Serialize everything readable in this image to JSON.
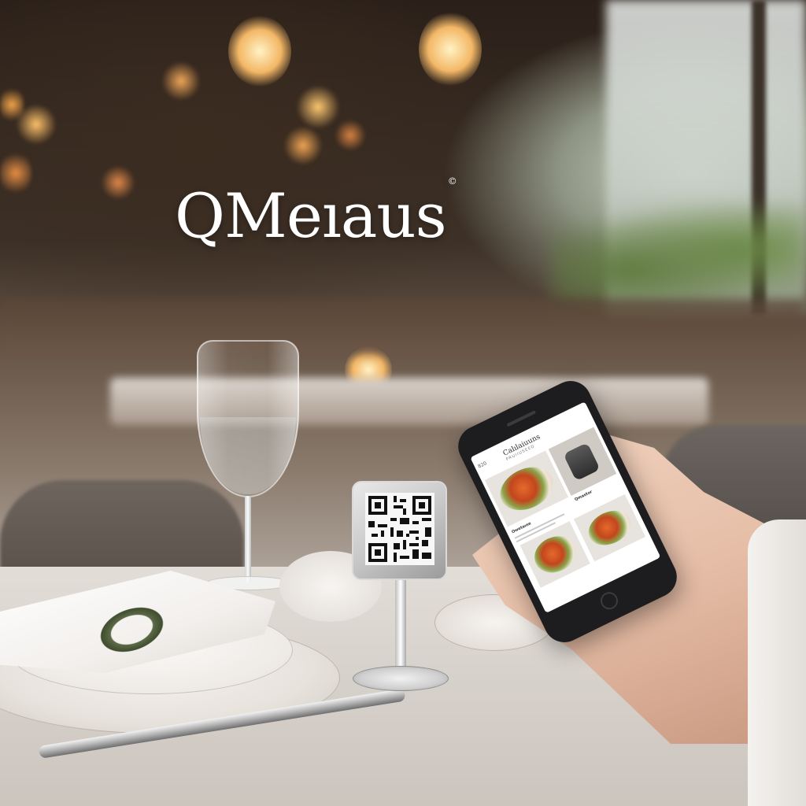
{
  "brand": {
    "logo_text": "QMeıaus",
    "registered_mark": "©"
  },
  "phone_screen": {
    "status_left": "820",
    "title": "Calılaiuuns",
    "subtitle": "PRUIIUSEED",
    "section_label": "Owetaıne",
    "section_label_2": "Qmastor"
  },
  "colors": {
    "logo": "#ffffff",
    "table": "#e2ddd7",
    "phone_body": "#1d1d1f",
    "warm_light": "#f3b766"
  },
  "icons": [
    "qr-code-icon",
    "home-button-icon"
  ]
}
